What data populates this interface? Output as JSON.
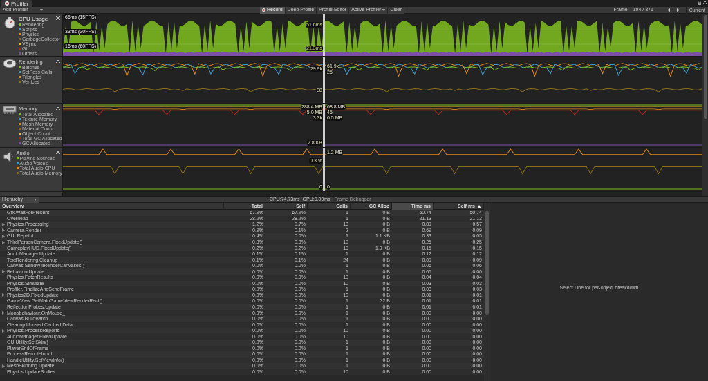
{
  "window": {
    "tab": "Profiler"
  },
  "toolbar": {
    "add_profiler": "Add Profiler",
    "buttons": [
      {
        "label": "Record",
        "selected": true,
        "kind": "record"
      },
      {
        "label": "Deep Profile",
        "selected": false,
        "kind": "plain"
      },
      {
        "label": "Profile Editor",
        "selected": false,
        "kind": "plain"
      },
      {
        "label": "Active Profiler",
        "selected": false,
        "kind": "dropdown"
      },
      {
        "label": "Clear",
        "selected": false,
        "kind": "plain"
      }
    ],
    "frame_label": "Frame:",
    "frame_value": "194 / 371",
    "current": "Current"
  },
  "modules": [
    {
      "kind": "cpu",
      "title": "CPU Usage",
      "legend": [
        {
          "label": "Rendering",
          "color": "#7fbf1e"
        },
        {
          "label": "Scripts",
          "color": "#3a9bd0"
        },
        {
          "label": "Physics",
          "color": "#e5891c"
        },
        {
          "label": "GarbageCollector",
          "color": "#8a6d1a"
        },
        {
          "label": "VSync",
          "color": "#e8c31b"
        },
        {
          "label": "Gi",
          "color": "#a8291a"
        },
        {
          "label": "Others",
          "color": "#7b4fa8"
        }
      ],
      "ticks": [
        "66ms (15FPS)",
        "33ms (30FPS)",
        "16ms (60FPS)"
      ],
      "readouts": [
        "51.6ms",
        "21.3ms"
      ]
    },
    {
      "kind": "rendering",
      "title": "Rendering",
      "legend": [
        {
          "label": "Batches",
          "color": "#7fbf1e"
        },
        {
          "label": "SetPass Calls",
          "color": "#3a9bd0"
        },
        {
          "label": "Triangles",
          "color": "#e5891c"
        },
        {
          "label": "Vertices",
          "color": "#8a6d1a"
        }
      ],
      "readouts": [
        "29.9k",
        "61.9k",
        "25",
        "38"
      ]
    },
    {
      "kind": "memory",
      "title": "Memory",
      "legend": [
        {
          "label": "Total Allocated",
          "color": "#7fbf1e"
        },
        {
          "label": "Texture Memory",
          "color": "#3a9bd0"
        },
        {
          "label": "Mesh Memory",
          "color": "#e5891c"
        },
        {
          "label": "Material Count",
          "color": "#8a6d1a"
        },
        {
          "label": "Object Count",
          "color": "#e8c31b"
        },
        {
          "label": "Total GC Allocated",
          "color": "#a8291a"
        },
        {
          "label": "GC Allocated",
          "color": "#7b4fa8"
        }
      ],
      "readouts": [
        "288.4 MB",
        "68.8 MB",
        "5.0 MB",
        "45",
        "3.3k",
        "6.5 MB",
        "2.8 KB"
      ]
    },
    {
      "kind": "audio",
      "title": "Audio",
      "legend": [
        {
          "label": "Playing Sources",
          "color": "#7fbf1e"
        },
        {
          "label": "Audio Voices",
          "color": "#3a9bd0"
        },
        {
          "label": "Total Audio CPU",
          "color": "#e5891c"
        },
        {
          "label": "Total Audio Memory",
          "color": "#8a6d1a"
        }
      ],
      "readouts": [
        "1.2 MB",
        "0.3 %",
        "0",
        "0"
      ]
    }
  ],
  "hierarchy_bar": {
    "view": "Hierarchy",
    "cpu": "CPU:74.73ms",
    "gpu": "GPU:0.00ms",
    "frame_debugger": "Frame Debugger"
  },
  "table": {
    "columns": [
      {
        "label": "Overview",
        "selected": false
      },
      {
        "label": "Total",
        "selected": false
      },
      {
        "label": "Self",
        "selected": false
      },
      {
        "label": "Calls",
        "selected": false
      },
      {
        "label": "GC Alloc",
        "selected": false
      },
      {
        "label": "Time ms",
        "selected": true
      },
      {
        "label": "Self ms",
        "selected": false
      }
    ],
    "rows": [
      {
        "expandable": false,
        "cells": [
          "Gfx.WaitForPresent",
          "67.9%",
          "67.9%",
          "1",
          "0 B",
          "50.74",
          "50.74"
        ]
      },
      {
        "expandable": false,
        "cells": [
          "Overhead",
          "28.2%",
          "28.2%",
          "1",
          "0 B",
          "21.13",
          "21.13"
        ]
      },
      {
        "expandable": true,
        "cells": [
          "Physics.Processing",
          "1.2%",
          "0.7%",
          "10",
          "0 B",
          "0.89",
          "0.57"
        ]
      },
      {
        "expandable": true,
        "cells": [
          "Camera.Render",
          "0.9%",
          "0.1%",
          "2",
          "0 B",
          "0.69",
          "0.09"
        ]
      },
      {
        "expandable": true,
        "cells": [
          "GUI.Repaint",
          "0.4%",
          "0.0%",
          "1",
          "1.1 KB",
          "0.33",
          "0.05"
        ]
      },
      {
        "expandable": true,
        "cells": [
          "ThirdPersonCamera.FixedUpdate()",
          "0.3%",
          "0.3%",
          "10",
          "0 B",
          "0.25",
          "0.25"
        ]
      },
      {
        "expandable": false,
        "cells": [
          "GameplayHUD.FixedUpdate()",
          "0.2%",
          "0.2%",
          "10",
          "1.9 KB",
          "0.15",
          "0.15"
        ]
      },
      {
        "expandable": false,
        "cells": [
          "AudioManager.Update",
          "0.1%",
          "0.1%",
          "1",
          "0 B",
          "0.12",
          "0.12"
        ]
      },
      {
        "expandable": false,
        "cells": [
          "TextRendering.Cleanup",
          "0.1%",
          "0.1%",
          "24",
          "0 B",
          "0.09",
          "0.09"
        ]
      },
      {
        "expandable": false,
        "cells": [
          "Canvas.SendWillRenderCanvases()",
          "0.0%",
          "0.0%",
          "1",
          "0 B",
          "0.06",
          "0.06"
        ]
      },
      {
        "expandable": true,
        "cells": [
          "BehaviourUpdate",
          "0.0%",
          "0.0%",
          "1",
          "0 B",
          "0.05",
          "0.00"
        ]
      },
      {
        "expandable": false,
        "cells": [
          "Physics.FetchResults",
          "0.0%",
          "0.0%",
          "10",
          "0 B",
          "0.04",
          "0.04"
        ]
      },
      {
        "expandable": false,
        "cells": [
          "Physics.Simulate",
          "0.0%",
          "0.0%",
          "10",
          "0 B",
          "0.03",
          "0.03"
        ]
      },
      {
        "expandable": false,
        "cells": [
          "Profiler.FinalizeAndSendFrame",
          "0.0%",
          "0.0%",
          "1",
          "0 B",
          "0.03",
          "0.03"
        ]
      },
      {
        "expandable": true,
        "cells": [
          "Physics2D.FixedUpdate",
          "0.0%",
          "0.0%",
          "10",
          "0 B",
          "0.01",
          "0.01"
        ]
      },
      {
        "expandable": false,
        "cells": [
          "GameView.GetMainGameViewRenderRect()",
          "0.0%",
          "0.0%",
          "1",
          "32 B",
          "0.01",
          "0.01"
        ]
      },
      {
        "expandable": false,
        "cells": [
          "ReflectionProbes.Update",
          "0.0%",
          "0.0%",
          "1",
          "0 B",
          "0.01",
          "0.01"
        ]
      },
      {
        "expandable": true,
        "cells": [
          "Monobehaviour.OnMouse_",
          "0.0%",
          "0.0%",
          "1",
          "0 B",
          "0.00",
          "0.00"
        ]
      },
      {
        "expandable": false,
        "cells": [
          "Canvas.BuildBatch",
          "0.0%",
          "0.0%",
          "1",
          "0 B",
          "0.00",
          "0.00"
        ]
      },
      {
        "expandable": false,
        "cells": [
          "Cleanup Unused Cached Data",
          "0.0%",
          "0.0%",
          "1",
          "0 B",
          "0.00",
          "0.00"
        ]
      },
      {
        "expandable": true,
        "cells": [
          "Physics.ProcessReports",
          "0.0%",
          "0.0%",
          "10",
          "0 B",
          "0.00",
          "0.00"
        ]
      },
      {
        "expandable": false,
        "cells": [
          "AudioManager.FixedUpdate",
          "0.0%",
          "0.0%",
          "10",
          "0 B",
          "0.00",
          "0.00"
        ]
      },
      {
        "expandable": false,
        "cells": [
          "GUIUtility.SetSkin()",
          "0.0%",
          "0.0%",
          "1",
          "0 B",
          "0.00",
          "0.00"
        ]
      },
      {
        "expandable": false,
        "cells": [
          "PlayerEndOfFrame",
          "0.0%",
          "0.0%",
          "1",
          "0 B",
          "0.00",
          "0.00"
        ]
      },
      {
        "expandable": false,
        "cells": [
          "ProcessRemoteInput",
          "0.0%",
          "0.0%",
          "1",
          "0 B",
          "0.00",
          "0.00"
        ]
      },
      {
        "expandable": false,
        "cells": [
          "HandleUtility.SetViewInfo()",
          "0.0%",
          "0.0%",
          "1",
          "0 B",
          "0.00",
          "0.00"
        ]
      },
      {
        "expandable": true,
        "cells": [
          "MeshSkinning.Update",
          "0.0%",
          "0.0%",
          "1",
          "0 B",
          "0.00",
          "0.00"
        ]
      },
      {
        "expandable": false,
        "cells": [
          "Physics.UpdateBodies",
          "0.0%",
          "0.0%",
          "10",
          "0 B",
          "0.00",
          "0.00"
        ]
      }
    ]
  },
  "details": {
    "hint": "Select Line for per-object breakdown"
  }
}
